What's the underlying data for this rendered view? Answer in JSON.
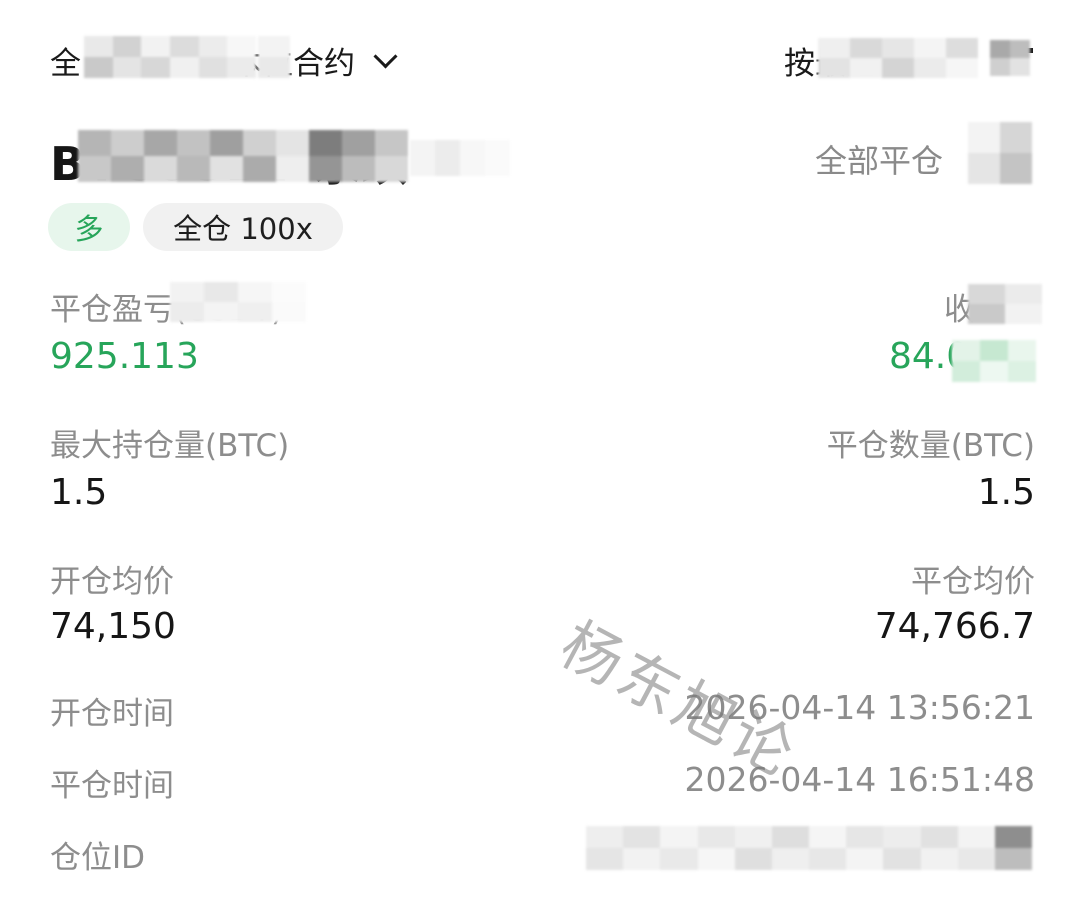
{
  "filter": {
    "contract_label_start": "全",
    "contract_label_end": "本位合约",
    "sort_label": "按最近"
  },
  "position": {
    "title": "BTCUSDT 永续",
    "close_all": "全部平仓",
    "tags": {
      "direction": "多",
      "margin_mode": "全仓 100x"
    }
  },
  "stats": {
    "pnl_label": "平仓盈亏(USDT)",
    "pnl_value": "925.113",
    "yield_label": "收",
    "yield_value": "84.0",
    "max_hold_label": "最大持仓量(BTC)",
    "max_hold_value": "1.5",
    "close_qty_label": "平仓数量(BTC)",
    "close_qty_value": "1.5",
    "open_avg_label": "开仓均价",
    "open_avg_value": "74,150",
    "close_avg_label": "平仓均价",
    "close_avg_value": "74,766.7",
    "open_time_label": "开仓时间",
    "open_time_value": "2026-04-14 13:56:21",
    "close_time_label": "平仓时间",
    "close_time_value": "2026-04-14 16:51:48",
    "position_id_label": "仓位ID"
  },
  "watermark": "杨东旭论",
  "colors": {
    "profit_green": "#27a55a",
    "long_tag_bg": "#e7f6ec",
    "muted_text": "#8d8d8d"
  }
}
